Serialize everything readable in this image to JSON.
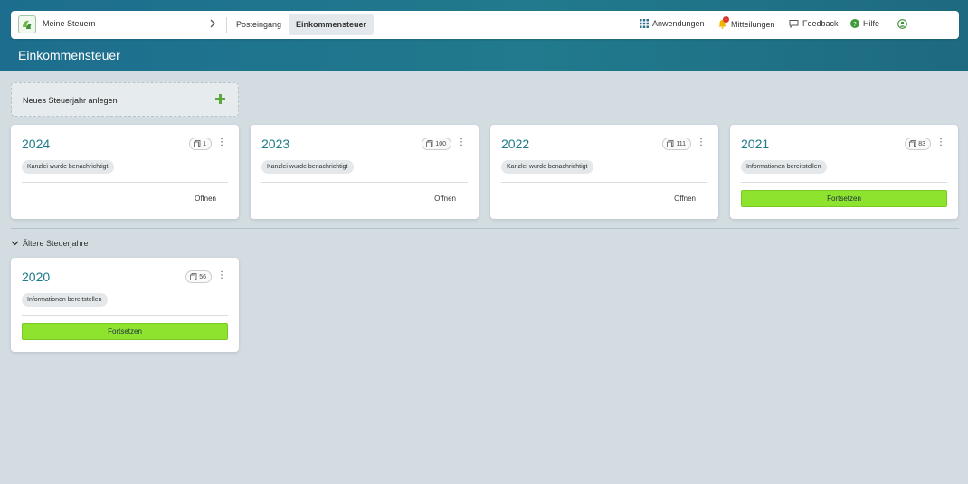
{
  "header": {
    "app_name": "Meine Steuern",
    "tabs": [
      {
        "label": "Posteingang",
        "active": false
      },
      {
        "label": "Einkommensteuer",
        "active": true
      }
    ],
    "apps_label": "Anwendungen",
    "messages_label": "Mitteilungen",
    "messages_badge": "1",
    "feedback_label": "Feedback",
    "help_label": "Hilfe",
    "icons": [
      "logo",
      "chevron-right-icon",
      "grid-icon",
      "bell-icon",
      "chat-icon",
      "help-icon",
      "user-icon"
    ]
  },
  "page": {
    "title": "Einkommensteuer"
  },
  "new_year": {
    "label": "Neues Steuerjahr anlegen",
    "icon": "plus-icon"
  },
  "cards": [
    {
      "year": "2024",
      "count": "1",
      "status": "Kanzlei wurde benachrichtigt",
      "action": "Öffnen",
      "action_type": "link"
    },
    {
      "year": "2023",
      "count": "100",
      "status": "Kanzlei wurde benachrichtigt",
      "action": "Öffnen",
      "action_type": "link"
    },
    {
      "year": "2022",
      "count": "111",
      "status": "Kanzlei wurde benachrichtigt",
      "action": "Öffnen",
      "action_type": "link"
    },
    {
      "year": "2021",
      "count": "83",
      "status": "Informationen bereitstellen",
      "action": "Fortsetzen",
      "action_type": "button"
    }
  ],
  "older": {
    "label": "Ältere Steuerjahre",
    "cards": [
      {
        "year": "2020",
        "count": "56",
        "status": "Informationen bereitstellen",
        "action": "Fortsetzen",
        "action_type": "button"
      }
    ]
  },
  "colors": {
    "header_gradient_start": "#1d6e8e",
    "header_gradient_end": "#1e6a80",
    "year_text": "#1e7a8a",
    "continue_button": "#8ee32e",
    "plus_icon": "#5aa83a",
    "page_bg": "#d2dce1"
  }
}
